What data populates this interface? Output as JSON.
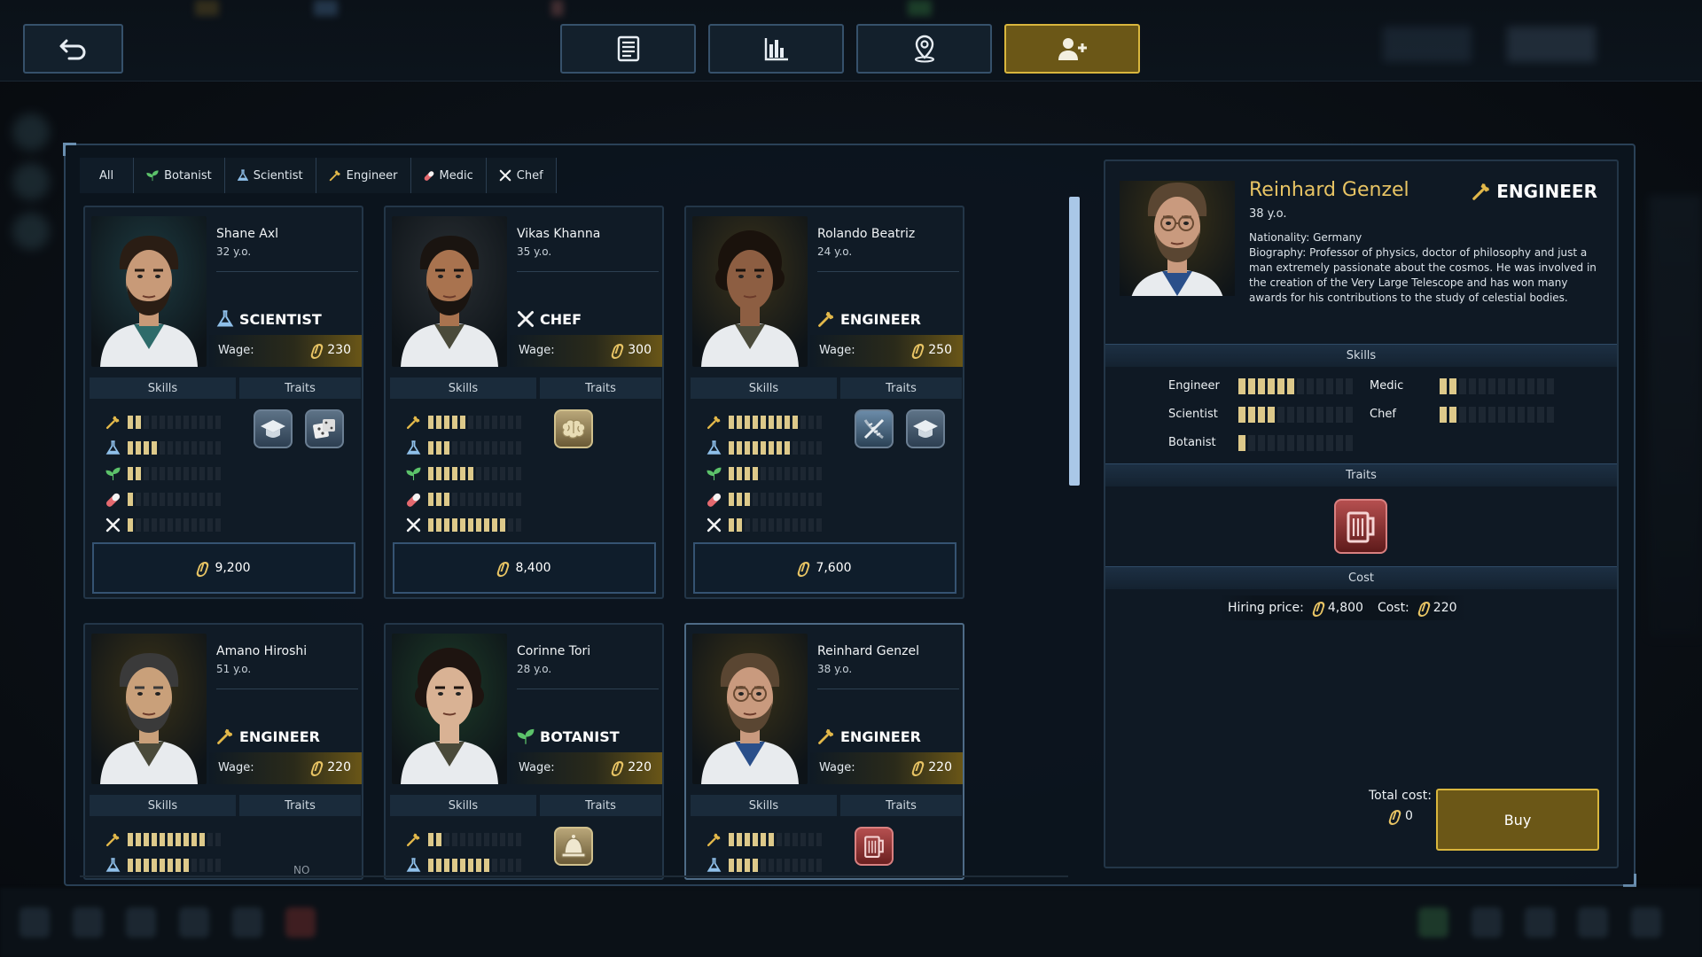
{
  "colors": {
    "accent_gold": "#d9b63d",
    "bar_on": "#ddc98a",
    "bar_off": "#1d2732",
    "panel_border": "#2a4157",
    "name_gold": "#e8c464"
  },
  "topbar": {
    "buttons": [
      {
        "id": "back",
        "icon": "back-arrow-icon"
      },
      {
        "id": "reports",
        "icon": "document-icon"
      },
      {
        "id": "stats",
        "icon": "bar-chart-icon"
      },
      {
        "id": "map",
        "icon": "map-pin-icon"
      },
      {
        "id": "hire",
        "icon": "add-user-icon",
        "active": true
      }
    ]
  },
  "filters": [
    {
      "label": "All"
    },
    {
      "label": "Botanist",
      "icon": "leaf-icon"
    },
    {
      "label": "Scientist",
      "icon": "flask-icon"
    },
    {
      "label": "Engineer",
      "icon": "wrench-icon"
    },
    {
      "label": "Medic",
      "icon": "pill-icon"
    },
    {
      "label": "Chef",
      "icon": "cutlery-icon"
    }
  ],
  "labels": {
    "wage": "Wage:",
    "skills": "Skills",
    "traits": "Traits",
    "no_traits": "NO",
    "cost": "Cost",
    "hiring_price": "Hiring price:",
    "cost_short": "Cost:",
    "total_cost": "Total cost:",
    "buy": "Buy"
  },
  "candidates": [
    {
      "name": "Shane Axl",
      "age": "32 y.o.",
      "role": "SCIENTIST",
      "role_icon": "flask-icon",
      "wage": "230",
      "price": "9,200",
      "skills": [
        2,
        4,
        2,
        1,
        1
      ],
      "traits": [
        "graduate-cap-icon",
        "dice-icon"
      ]
    },
    {
      "name": "Vikas Khanna",
      "age": "35 y.o.",
      "role": "CHEF",
      "role_icon": "cutlery-icon",
      "wage": "300",
      "price": "8,400",
      "skills": [
        5,
        3,
        6,
        3,
        10
      ],
      "traits": [
        "brain-icon"
      ]
    },
    {
      "name": "Rolando Beatriz",
      "age": "24 y.o.",
      "role": "ENGINEER",
      "role_icon": "wrench-icon",
      "wage": "250",
      "price": "7,600",
      "skills": [
        9,
        8,
        4,
        3,
        2
      ],
      "traits": [
        "dna-icon",
        "graduate-cap-icon"
      ]
    },
    {
      "name": "Amano Hiroshi",
      "age": "51 y.o.",
      "role": "ENGINEER",
      "role_icon": "wrench-icon",
      "wage": "220",
      "skills": [
        10,
        8
      ],
      "traits": []
    },
    {
      "name": "Corinne Tori",
      "age": "28 y.o.",
      "role": "BOTANIST",
      "role_icon": "leaf-icon",
      "wage": "220",
      "skills": [
        2,
        8
      ],
      "traits": [
        "bell-icon"
      ]
    },
    {
      "name": "Reinhard Genzel",
      "age": "38 y.o.",
      "role": "ENGINEER",
      "role_icon": "wrench-icon",
      "wage": "220",
      "skills": [
        6,
        4
      ],
      "traits": [
        "beer-mug-icon"
      ],
      "selected": true
    }
  ],
  "detail": {
    "name": "Reinhard Genzel",
    "role": "ENGINEER",
    "age": "38 y.o.",
    "nationality": "Nationality: Germany",
    "biography": "Biography: Professor of physics, doctor of philosophy and just a man extremely passionate about the cosmos. He was involved in the creation of the Very Large Telescope and has won many awards for his contributions to the study of celestial bodies.",
    "skills": [
      {
        "label": "Engineer",
        "value": 6
      },
      {
        "label": "Scientist",
        "value": 4
      },
      {
        "label": "Botanist",
        "value": 1
      },
      {
        "label": "Medic",
        "value": 2
      },
      {
        "label": "Chef",
        "value": 2
      }
    ],
    "trait": "beer-mug-icon",
    "hiring_price": "4,800",
    "cost": "220",
    "total": "0"
  }
}
